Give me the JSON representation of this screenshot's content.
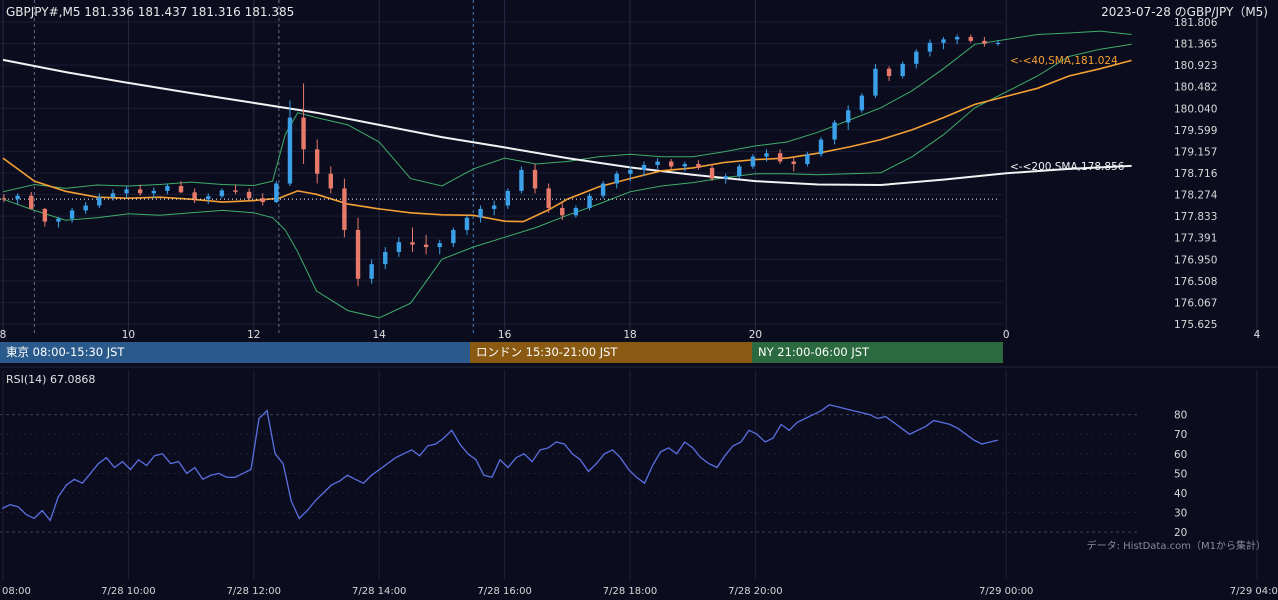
{
  "header": {
    "symbol_info": "GBPJPY#,M5 181.336 181.437 181.316 181.385",
    "title_right": "2023-07-28 のGBP/JPY（M5)"
  },
  "sessions": [
    {
      "label": "東京 08:00-15:30 JST",
      "color": "#2a5a8c"
    },
    {
      "label": "ロンドン 15:30-21:00 JST",
      "color": "#8a5a12"
    },
    {
      "label": "NY 21:00-06:00 JST",
      "color": "#2b6a3e"
    }
  ],
  "rsi_label": "RSI(14) 67.0868",
  "credit": "データ: HistData.com（M1から集計）",
  "colors": {
    "background": "#0b0c1e",
    "candle_up": "#3aa0e8",
    "candle_down": "#e87a6a",
    "sma40": "#f5a033",
    "sma200": "#f2f2f2",
    "bollinger": "#3fae6a",
    "rsi": "#5b6fe0"
  },
  "chart_data": [
    {
      "type": "candlestick",
      "title": "",
      "y_ticks": [
        "181.806",
        "181.365",
        "180.923",
        "180.482",
        "180.040",
        "179.599",
        "179.157",
        "178.716",
        "178.274",
        "177.833",
        "177.391",
        "176.950",
        "176.508",
        "176.067",
        "175.625"
      ],
      "ylim": [
        175.625,
        181.806
      ],
      "x_ticks": [
        "8",
        "10",
        "12",
        "14",
        "16",
        "18",
        "20",
        "0",
        "4"
      ],
      "x_ticks_bottom": [
        "08:00",
        "7/28 10:00",
        "7/28 12:00",
        "7/28 14:00",
        "7/28 16:00",
        "7/28 18:00",
        "7/28 20:00",
        "7/29 00:00",
        "7/29 04:00"
      ],
      "price_line": 178.18,
      "series": [
        {
          "name": "40,SMA",
          "label": "<-<40,SMA,181.024",
          "last": 181.024,
          "points": [
            [
              8.0,
              179.02
            ],
            [
              8.5,
              178.55
            ],
            [
              9.0,
              178.34
            ],
            [
              9.5,
              178.22
            ],
            [
              10.0,
              178.2
            ],
            [
              10.5,
              178.22
            ],
            [
              11.0,
              178.18
            ],
            [
              11.5,
              178.12
            ],
            [
              12.0,
              178.15
            ],
            [
              12.4,
              178.2
            ],
            [
              12.7,
              178.35
            ],
            [
              13.0,
              178.28
            ],
            [
              13.5,
              178.08
            ],
            [
              14.0,
              177.98
            ],
            [
              14.5,
              177.9
            ],
            [
              15.0,
              177.86
            ],
            [
              15.5,
              177.85
            ],
            [
              16.0,
              177.73
            ],
            [
              16.3,
              177.72
            ],
            [
              16.7,
              177.96
            ],
            [
              17.0,
              178.18
            ],
            [
              17.5,
              178.43
            ],
            [
              18.0,
              178.6
            ],
            [
              18.5,
              178.76
            ],
            [
              19.0,
              178.82
            ],
            [
              19.5,
              178.93
            ],
            [
              20.0,
              178.99
            ],
            [
              20.5,
              179.02
            ],
            [
              21.0,
              179.12
            ],
            [
              21.5,
              179.25
            ],
            [
              22.0,
              179.4
            ],
            [
              22.5,
              179.6
            ],
            [
              23.0,
              179.85
            ],
            [
              23.5,
              180.12
            ],
            [
              0.5,
              180.45
            ],
            [
              1.0,
              180.7
            ],
            [
              1.5,
              180.85
            ],
            [
              2.0,
              181.02
            ]
          ]
        },
        {
          "name": "200,SMA",
          "label": "<-<200,SMA,178.856",
          "last": 178.856,
          "points": [
            [
              8.0,
              181.03
            ],
            [
              9.0,
              180.78
            ],
            [
              10.0,
              180.56
            ],
            [
              11.0,
              180.35
            ],
            [
              12.0,
              180.15
            ],
            [
              13.0,
              179.95
            ],
            [
              14.0,
              179.7
            ],
            [
              15.0,
              179.45
            ],
            [
              16.0,
              179.24
            ],
            [
              17.0,
              179.02
            ],
            [
              18.0,
              178.83
            ],
            [
              19.0,
              178.68
            ],
            [
              20.0,
              178.55
            ],
            [
              21.0,
              178.48
            ],
            [
              22.0,
              178.47
            ],
            [
              23.0,
              178.58
            ],
            [
              0.0,
              178.71
            ],
            [
              1.0,
              178.8
            ],
            [
              2.0,
              178.86
            ]
          ]
        }
      ],
      "bollinger": {
        "upper": [
          [
            8.0,
            178.33
          ],
          [
            8.5,
            178.48
          ],
          [
            9.0,
            178.4
          ],
          [
            9.5,
            178.47
          ],
          [
            10.0,
            178.45
          ],
          [
            10.5,
            178.48
          ],
          [
            11.0,
            178.53
          ],
          [
            11.5,
            178.48
          ],
          [
            12.0,
            178.46
          ],
          [
            12.3,
            178.55
          ],
          [
            12.5,
            179.5
          ],
          [
            12.7,
            179.95
          ],
          [
            13.0,
            179.85
          ],
          [
            13.5,
            179.7
          ],
          [
            14.0,
            179.35
          ],
          [
            14.5,
            178.6
          ],
          [
            15.0,
            178.45
          ],
          [
            15.5,
            178.8
          ],
          [
            16.0,
            179.02
          ],
          [
            16.5,
            178.9
          ],
          [
            17.0,
            178.95
          ],
          [
            17.5,
            179.05
          ],
          [
            18.0,
            179.1
          ],
          [
            18.5,
            179.05
          ],
          [
            19.0,
            179.05
          ],
          [
            19.5,
            179.15
          ],
          [
            20.0,
            179.27
          ],
          [
            20.5,
            179.35
          ],
          [
            21.0,
            179.55
          ],
          [
            21.5,
            179.8
          ],
          [
            22.0,
            180.05
          ],
          [
            22.5,
            180.4
          ],
          [
            23.0,
            180.85
          ],
          [
            23.5,
            181.35
          ],
          [
            0.5,
            181.55
          ],
          [
            1.0,
            181.58
          ],
          [
            1.5,
            181.62
          ],
          [
            2.0,
            181.55
          ]
        ],
        "lower": [
          [
            8.0,
            178.18
          ],
          [
            8.5,
            177.95
          ],
          [
            9.0,
            177.75
          ],
          [
            9.5,
            177.8
          ],
          [
            10.0,
            177.88
          ],
          [
            10.5,
            177.85
          ],
          [
            11.0,
            177.9
          ],
          [
            11.5,
            177.95
          ],
          [
            12.0,
            177.9
          ],
          [
            12.3,
            177.8
          ],
          [
            12.5,
            177.55
          ],
          [
            12.7,
            177.1
          ],
          [
            13.0,
            176.3
          ],
          [
            13.5,
            175.9
          ],
          [
            14.0,
            175.75
          ],
          [
            14.5,
            176.05
          ],
          [
            15.0,
            176.95
          ],
          [
            15.5,
            177.2
          ],
          [
            16.0,
            177.4
          ],
          [
            16.5,
            177.6
          ],
          [
            17.0,
            177.85
          ],
          [
            17.5,
            178.08
          ],
          [
            18.0,
            178.33
          ],
          [
            18.5,
            178.45
          ],
          [
            19.0,
            178.52
          ],
          [
            19.5,
            178.62
          ],
          [
            20.0,
            178.7
          ],
          [
            20.5,
            178.7
          ],
          [
            21.0,
            178.68
          ],
          [
            21.5,
            178.7
          ],
          [
            22.0,
            178.72
          ],
          [
            22.5,
            179.05
          ],
          [
            23.0,
            179.5
          ],
          [
            23.5,
            180.05
          ],
          [
            0.5,
            180.7
          ],
          [
            1.0,
            181.1
          ],
          [
            1.5,
            181.25
          ],
          [
            2.0,
            181.35
          ]
        ]
      },
      "candles": [
        [
          178.2,
          178.28,
          178.12,
          178.18
        ],
        [
          178.18,
          178.3,
          178.08,
          178.25
        ],
        [
          178.25,
          178.33,
          178.05,
          177.98
        ],
        [
          177.98,
          178.0,
          177.62,
          177.72
        ],
        [
          177.72,
          177.82,
          177.6,
          177.78
        ],
        [
          177.78,
          178.0,
          177.7,
          177.95
        ],
        [
          177.95,
          178.12,
          177.88,
          178.05
        ],
        [
          178.05,
          178.3,
          178.0,
          178.22
        ],
        [
          178.22,
          178.38,
          178.15,
          178.3
        ],
        [
          178.3,
          178.45,
          178.2,
          178.38
        ],
        [
          178.38,
          178.48,
          178.25,
          178.3
        ],
        [
          178.3,
          178.42,
          178.2,
          178.35
        ],
        [
          178.35,
          178.5,
          178.28,
          178.45
        ],
        [
          178.45,
          178.55,
          178.3,
          178.32
        ],
        [
          178.32,
          178.4,
          178.1,
          178.18
        ],
        [
          178.18,
          178.3,
          178.08,
          178.24
        ],
        [
          178.24,
          178.4,
          178.2,
          178.36
        ],
        [
          178.36,
          178.48,
          178.28,
          178.33
        ],
        [
          178.33,
          178.4,
          178.15,
          178.2
        ],
        [
          178.2,
          178.3,
          178.05,
          178.12
        ],
        [
          178.12,
          178.55,
          178.1,
          178.5
        ],
        [
          178.5,
          180.2,
          178.45,
          179.85
        ],
        [
          179.85,
          180.55,
          178.9,
          179.2
        ],
        [
          179.2,
          179.4,
          178.5,
          178.7
        ],
        [
          178.7,
          178.85,
          178.3,
          178.4
        ],
        [
          178.4,
          178.6,
          177.4,
          177.55
        ],
        [
          177.55,
          177.8,
          176.4,
          176.55
        ],
        [
          176.55,
          176.95,
          176.45,
          176.85
        ],
        [
          176.85,
          177.2,
          176.75,
          177.1
        ],
        [
          177.1,
          177.4,
          177.0,
          177.3
        ],
        [
          177.3,
          177.6,
          177.1,
          177.25
        ],
        [
          177.25,
          177.45,
          177.05,
          177.2
        ],
        [
          177.2,
          177.35,
          177.05,
          177.28
        ],
        [
          177.28,
          177.6,
          177.2,
          177.55
        ],
        [
          177.55,
          177.85,
          177.45,
          177.8
        ],
        [
          177.8,
          178.05,
          177.7,
          177.98
        ],
        [
          177.98,
          178.15,
          177.85,
          178.05
        ],
        [
          178.05,
          178.4,
          177.98,
          178.35
        ],
        [
          178.35,
          178.85,
          178.3,
          178.78
        ],
        [
          178.78,
          178.9,
          178.3,
          178.4
        ],
        [
          178.4,
          178.5,
          177.9,
          178.0
        ],
        [
          178.0,
          178.1,
          177.75,
          177.85
        ],
        [
          177.85,
          178.05,
          177.8,
          178.0
        ],
        [
          178.0,
          178.3,
          177.95,
          178.25
        ],
        [
          178.25,
          178.55,
          178.2,
          178.5
        ],
        [
          178.5,
          178.75,
          178.4,
          178.7
        ],
        [
          178.7,
          178.85,
          178.55,
          178.78
        ],
        [
          178.78,
          178.95,
          178.65,
          178.88
        ],
        [
          178.88,
          179.02,
          178.8,
          178.95
        ],
        [
          178.95,
          179.0,
          178.8,
          178.85
        ],
        [
          178.85,
          178.95,
          178.75,
          178.9
        ],
        [
          178.9,
          178.98,
          178.78,
          178.82
        ],
        [
          178.82,
          178.9,
          178.55,
          178.6
        ],
        [
          178.6,
          178.7,
          178.5,
          178.65
        ],
        [
          178.65,
          178.9,
          178.6,
          178.85
        ],
        [
          178.85,
          179.1,
          178.8,
          179.05
        ],
        [
          179.05,
          179.2,
          178.95,
          179.12
        ],
        [
          179.12,
          179.2,
          178.9,
          178.95
        ],
        [
          178.95,
          179.05,
          178.75,
          178.9
        ],
        [
          178.9,
          179.15,
          178.85,
          179.1
        ],
        [
          179.1,
          179.45,
          179.05,
          179.4
        ],
        [
          179.4,
          179.8,
          179.3,
          179.75
        ],
        [
          179.75,
          180.1,
          179.6,
          180.0
        ],
        [
          180.0,
          180.35,
          179.95,
          180.3
        ],
        [
          180.3,
          180.95,
          180.25,
          180.85
        ],
        [
          180.85,
          180.9,
          180.6,
          180.7
        ],
        [
          180.7,
          181.0,
          180.65,
          180.95
        ],
        [
          180.95,
          181.25,
          180.85,
          181.2
        ],
        [
          181.2,
          181.45,
          181.1,
          181.38
        ],
        [
          181.38,
          181.5,
          181.25,
          181.45
        ],
        [
          181.45,
          181.55,
          181.35,
          181.5
        ],
        [
          181.5,
          181.55,
          181.38,
          181.42
        ],
        [
          181.42,
          181.5,
          181.3,
          181.36
        ],
        [
          181.36,
          181.44,
          181.32,
          181.38
        ]
      ]
    },
    {
      "type": "line",
      "title": "",
      "series_label": "RSI(14) 67.0868",
      "y_ticks": [
        "80",
        "70",
        "60",
        "50",
        "40",
        "30",
        "20"
      ],
      "ylim": [
        16,
        90
      ],
      "values": [
        32,
        34,
        33,
        29,
        27,
        31,
        26,
        38,
        44,
        47,
        45,
        50,
        55,
        58,
        53,
        56,
        52,
        57,
        54,
        59,
        60,
        55,
        56,
        50,
        53,
        47,
        49,
        50,
        48,
        48,
        50,
        52,
        78,
        82,
        60,
        55,
        36,
        27,
        31,
        36,
        40,
        44,
        46,
        49,
        47,
        45,
        49,
        52,
        55,
        58,
        60,
        62,
        59,
        64,
        65,
        68,
        72,
        65,
        60,
        57,
        49,
        48,
        57,
        53,
        58,
        60,
        56,
        62,
        63,
        66,
        65,
        60,
        57,
        51,
        55,
        60,
        62,
        58,
        52,
        48,
        45,
        54,
        61,
        63,
        60,
        66,
        63,
        58,
        55,
        53,
        59,
        64,
        66,
        72,
        70,
        66,
        68,
        75,
        72,
        76,
        78,
        80,
        82,
        85,
        84,
        83,
        82,
        81,
        80,
        78,
        79,
        76,
        73,
        70,
        72,
        74,
        77,
        76,
        75,
        73,
        70,
        67,
        65,
        66,
        67
      ]
    }
  ]
}
